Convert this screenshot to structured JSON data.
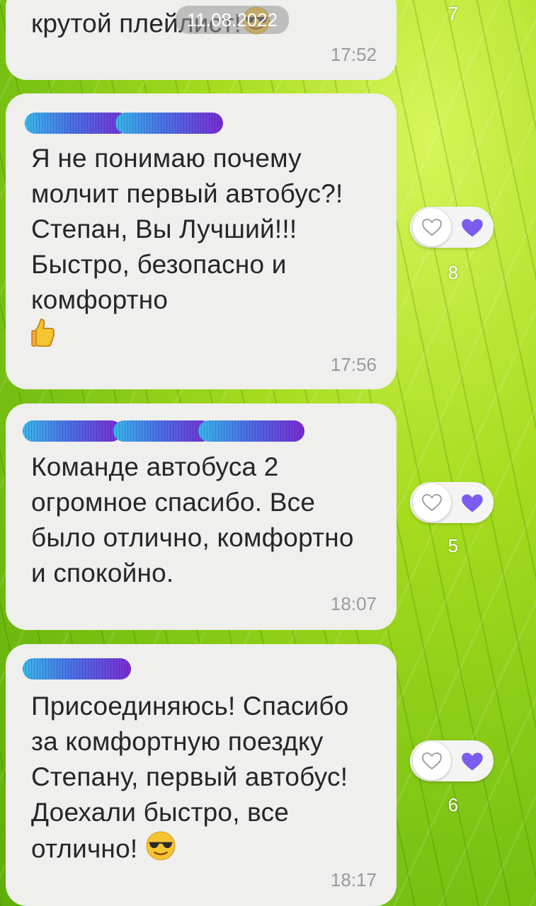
{
  "messages": [
    {
      "text": "крутой плейлист!",
      "time": "17:52",
      "reactions": "7"
    },
    {
      "text": "Я не понимаю почему молчит первый автобус?! Степан, Вы Лучший!!! Быстро, безопасно и комфортно",
      "time": "17:56",
      "reactions": "8"
    },
    {
      "text": "Команде автобуса 2 огромное спасибо. Все было отлично, комфортно  и спокойно.",
      "time": "18:07",
      "reactions": "5"
    },
    {
      "text": "Присоединяюсь! Спасибо за комфортную поездку Степану, первый автобус! Доехали быстро, все отлично!",
      "time": "18:17",
      "reactions": "6"
    }
  ],
  "date_badge": "11.08.2022",
  "colors": {
    "bubble": "#efefee",
    "text": "#262626",
    "time": "#9a9a9a",
    "heart_accent": "#7b5cf0",
    "redaction_start": "#3ab8ee",
    "redaction_end": "#7b2bd6"
  },
  "icons": [
    "sunglasses-emoji",
    "thumbs-up-emoji",
    "heart-outline-icon",
    "heart-filled-icon"
  ]
}
